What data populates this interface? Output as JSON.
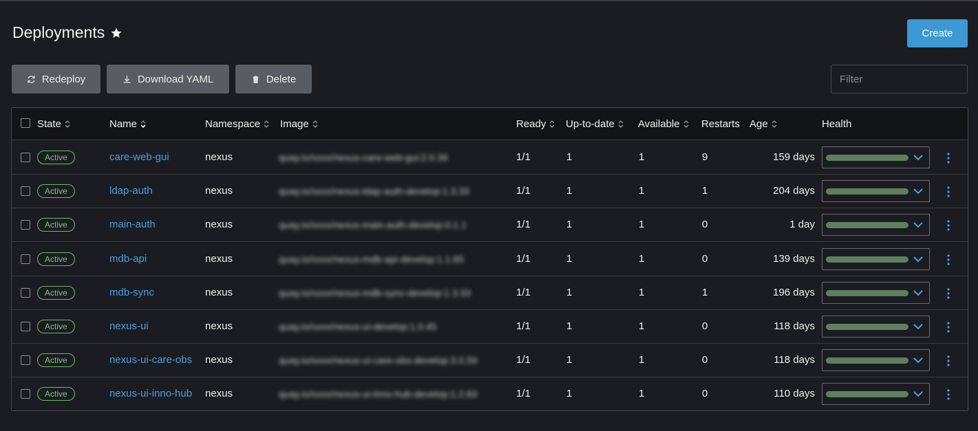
{
  "header": {
    "title": "Deployments",
    "create_label": "Create"
  },
  "toolbar": {
    "redeploy_label": "Redeploy",
    "download_label": "Download YAML",
    "delete_label": "Delete",
    "filter_placeholder": "Filter"
  },
  "columns": {
    "state": "State",
    "name": "Name",
    "namespace": "Namespace",
    "image": "Image",
    "ready": "Ready",
    "uptodate": "Up-to-date",
    "available": "Available",
    "restarts": "Restarts",
    "age": "Age",
    "health": "Health"
  },
  "colors": {
    "accent": "#3d98d3",
    "link": "#4a9fe0",
    "active": "#7cc47c",
    "health_bar": "#5e7f5e"
  },
  "rows": [
    {
      "state": "Active",
      "name": "care-web-gui",
      "namespace": "nexus",
      "image": "quay.io/xxxx/nexus-care-web-gui:2.0.39",
      "ready": "1/1",
      "uptodate": "1",
      "available": "1",
      "restarts": "9",
      "age": "159 days"
    },
    {
      "state": "Active",
      "name": "ldap-auth",
      "namespace": "nexus",
      "image": "quay.io/xxxx/nexus-ldap-auth-develop:1.3.33",
      "ready": "1/1",
      "uptodate": "1",
      "available": "1",
      "restarts": "1",
      "age": "204 days"
    },
    {
      "state": "Active",
      "name": "main-auth",
      "namespace": "nexus",
      "image": "quay.io/xxxx/nexus-main-auth-develop:0.1.1",
      "ready": "1/1",
      "uptodate": "1",
      "available": "1",
      "restarts": "0",
      "age": "1 day"
    },
    {
      "state": "Active",
      "name": "mdb-api",
      "namespace": "nexus",
      "image": "quay.io/xxxx/nexus-mdb-api-develop:1.1.65",
      "ready": "1/1",
      "uptodate": "1",
      "available": "1",
      "restarts": "0",
      "age": "139 days"
    },
    {
      "state": "Active",
      "name": "mdb-sync",
      "namespace": "nexus",
      "image": "quay.io/xxxx/nexus-mdb-sync-develop:1.3.33",
      "ready": "1/1",
      "uptodate": "1",
      "available": "1",
      "restarts": "1",
      "age": "196 days"
    },
    {
      "state": "Active",
      "name": "nexus-ui",
      "namespace": "nexus",
      "image": "quay.io/xxxx/nexus-ui-develop:1.0.45",
      "ready": "1/1",
      "uptodate": "1",
      "available": "1",
      "restarts": "0",
      "age": "118 days"
    },
    {
      "state": "Active",
      "name": "nexus-ui-care-obs",
      "namespace": "nexus",
      "image": "quay.io/xxxx/nexus-ui-care-obs-develop:3.0.59",
      "ready": "1/1",
      "uptodate": "1",
      "available": "1",
      "restarts": "0",
      "age": "118 days"
    },
    {
      "state": "Active",
      "name": "nexus-ui-inno-hub",
      "namespace": "nexus",
      "image": "quay.io/xxxx/nexus-ui-inno-hub-develop:1.2.63",
      "ready": "1/1",
      "uptodate": "1",
      "available": "1",
      "restarts": "0",
      "age": "110 days"
    }
  ]
}
